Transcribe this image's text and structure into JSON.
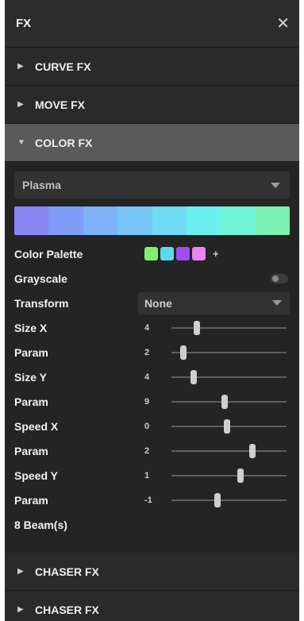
{
  "header": {
    "title": "FX",
    "close_icon": "close-icon"
  },
  "sections": {
    "curve": "CURVE FX",
    "move": "MOVE FX",
    "color": "COLOR FX",
    "chaser1": "CHASER FX",
    "chaser2": "CHASER FX"
  },
  "color_fx": {
    "effect": "Plasma",
    "preview_colors": [
      "#8a86f5",
      "#7f9cf7",
      "#7db1f8",
      "#77c6f6",
      "#6fdcf3",
      "#6cf0ef",
      "#70f4d6",
      "#7bf2b4"
    ],
    "palette_label": "Color Palette",
    "palette_swatches": [
      "#7ff06c",
      "#5ad8ee",
      "#a24df0",
      "#e885ef"
    ],
    "palette_add": "+",
    "grayscale_label": "Grayscale",
    "grayscale_on": false,
    "transform_label": "Transform",
    "transform_value": "None",
    "sliders": [
      {
        "label": "Size X",
        "value": "4",
        "level": 0.22
      },
      {
        "label": "Param",
        "value": "2",
        "level": 0.1
      },
      {
        "label": "Size Y",
        "value": "4",
        "level": 0.19
      },
      {
        "label": "Param",
        "value": "9",
        "level": 0.46
      },
      {
        "label": "Speed X",
        "value": "0",
        "level": 0.48
      },
      {
        "label": "Param",
        "value": "2",
        "level": 0.7
      },
      {
        "label": "Speed Y",
        "value": "1",
        "level": 0.6
      },
      {
        "label": "Param",
        "value": "-1",
        "level": 0.4
      }
    ],
    "beams": "8 Beam(s)"
  }
}
